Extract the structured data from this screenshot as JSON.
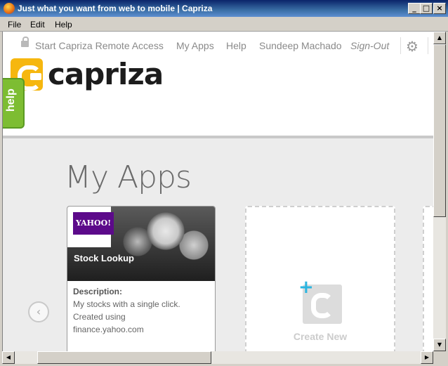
{
  "window": {
    "title": "Just what you want from web to mobile | Capriza",
    "min": "_",
    "max": "□",
    "close": "×"
  },
  "menu": {
    "file": "File",
    "edit": "Edit",
    "help": "Help"
  },
  "nav": {
    "remote_access": "Start Capriza Remote Access",
    "my_apps": "My Apps",
    "help": "Help",
    "user": "Sundeep Machado",
    "sign_out": "Sign-Out"
  },
  "logo": {
    "text": "capriza",
    "brand_color": "#f6b70f"
  },
  "help_tab": {
    "label": "help",
    "color": "#7dbd32"
  },
  "page": {
    "title": "My Apps"
  },
  "apps": [
    {
      "name": "Stock Lookup",
      "thumb_label": "YAHOO!",
      "description_label": "Description:",
      "description_lines": [
        "My stocks with a single click.",
        "Created using",
        "finance.yahoo.com"
      ]
    }
  ],
  "create_new": {
    "label": "Create New",
    "plus": "+",
    "accent": "#2ab5e0"
  },
  "icons": {
    "lock": "lock-icon",
    "gear": "gear-icon",
    "prev": "chevron-left-icon"
  }
}
